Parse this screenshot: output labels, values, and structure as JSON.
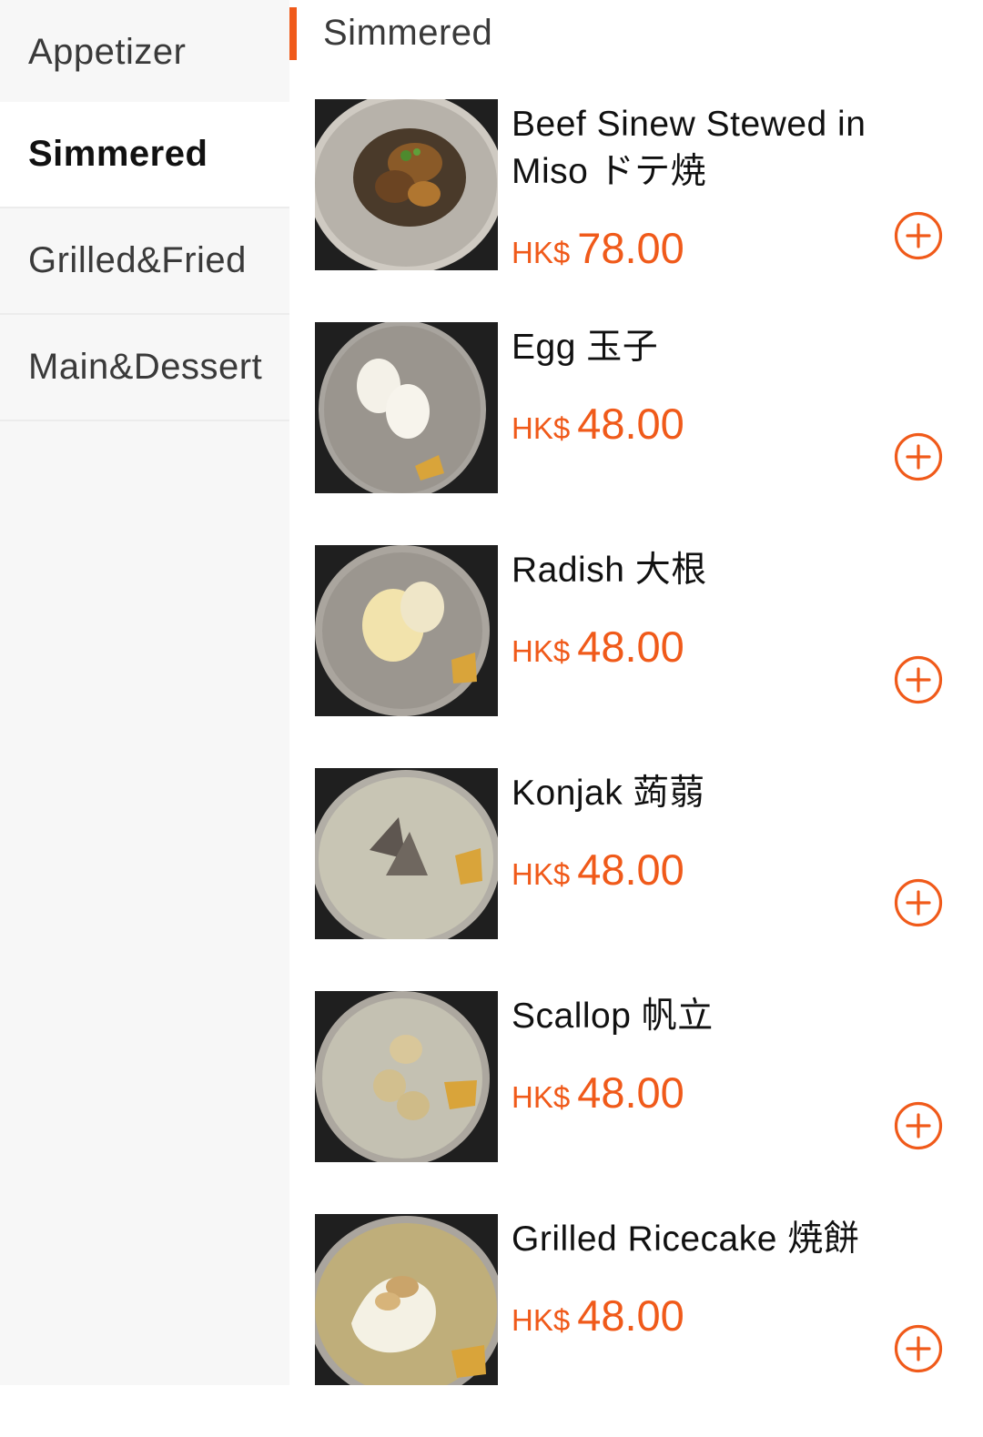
{
  "sidebar": {
    "categories": [
      {
        "label": "Appetizer",
        "active": false
      },
      {
        "label": "Simmered",
        "active": true
      },
      {
        "label": "Grilled&Fried",
        "active": false
      },
      {
        "label": "Main&Dessert",
        "active": false
      }
    ]
  },
  "section": {
    "title": "Simmered"
  },
  "items": [
    {
      "name": "Beef Sinew Stewed in Miso ドテ焼",
      "currency": "HK$",
      "price": "78.00"
    },
    {
      "name": "Egg 玉子",
      "currency": "HK$",
      "price": "48.00"
    },
    {
      "name": "Radish 大根",
      "currency": "HK$",
      "price": "48.00"
    },
    {
      "name": "Konjak 蒟蒻",
      "currency": "HK$",
      "price": "48.00"
    },
    {
      "name": "Scallop 帆立",
      "currency": "HK$",
      "price": "48.00"
    },
    {
      "name": "Grilled Ricecake 焼餅",
      "currency": "HK$",
      "price": "48.00"
    }
  ],
  "colors": {
    "accent": "#f05a1a",
    "sidebar_bg": "#f7f7f7"
  },
  "icons": {
    "add": "plus-circle-icon"
  }
}
